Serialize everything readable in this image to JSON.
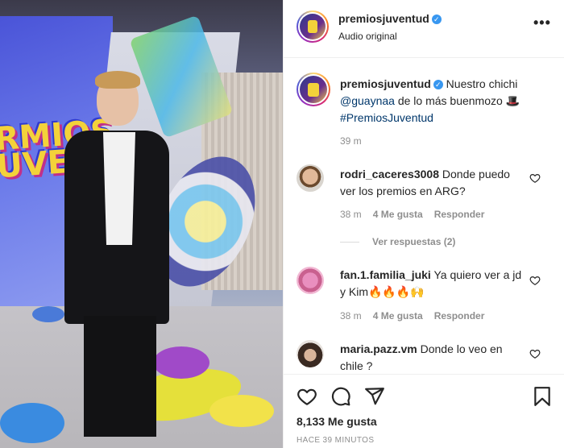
{
  "post": {
    "username": "premiosjuventud",
    "audio": "Audio original",
    "more_icon": "more-horizontal-icon"
  },
  "caption": {
    "username": "premiosjuventud",
    "text_before": " Nuestro chichi ",
    "mention": "@guaynaa",
    "text_after": " de lo más buenmozo 🎩 ",
    "hashtag": "#PremiosJuventud",
    "time": "39 m"
  },
  "comments": [
    {
      "username": "rodri_caceres3008",
      "text": " Donde puedo ver los premios en ARG?",
      "time": "38 m",
      "likes": "4 Me gusta",
      "reply": "Responder",
      "view_replies": "Ver respuestas (2)"
    },
    {
      "username": "fan.1.familia_juki",
      "text": " Ya quiero ver a jd y Kim🔥🔥🔥🙌",
      "time": "38 m",
      "likes": "4 Me gusta",
      "reply": "Responder"
    },
    {
      "username": "maria.pazz.vm",
      "text": " Donde lo veo en chile ?"
    }
  ],
  "actions": {
    "like_count": "8,133 Me gusta",
    "posted_ago": "HACE 39 MINUTOS"
  },
  "photo": {
    "sign_text": "PREMIOS JUVENTUD"
  },
  "colors": {
    "link": "#00376b",
    "verified": "#3897f0",
    "muted": "#8e8e8e"
  }
}
